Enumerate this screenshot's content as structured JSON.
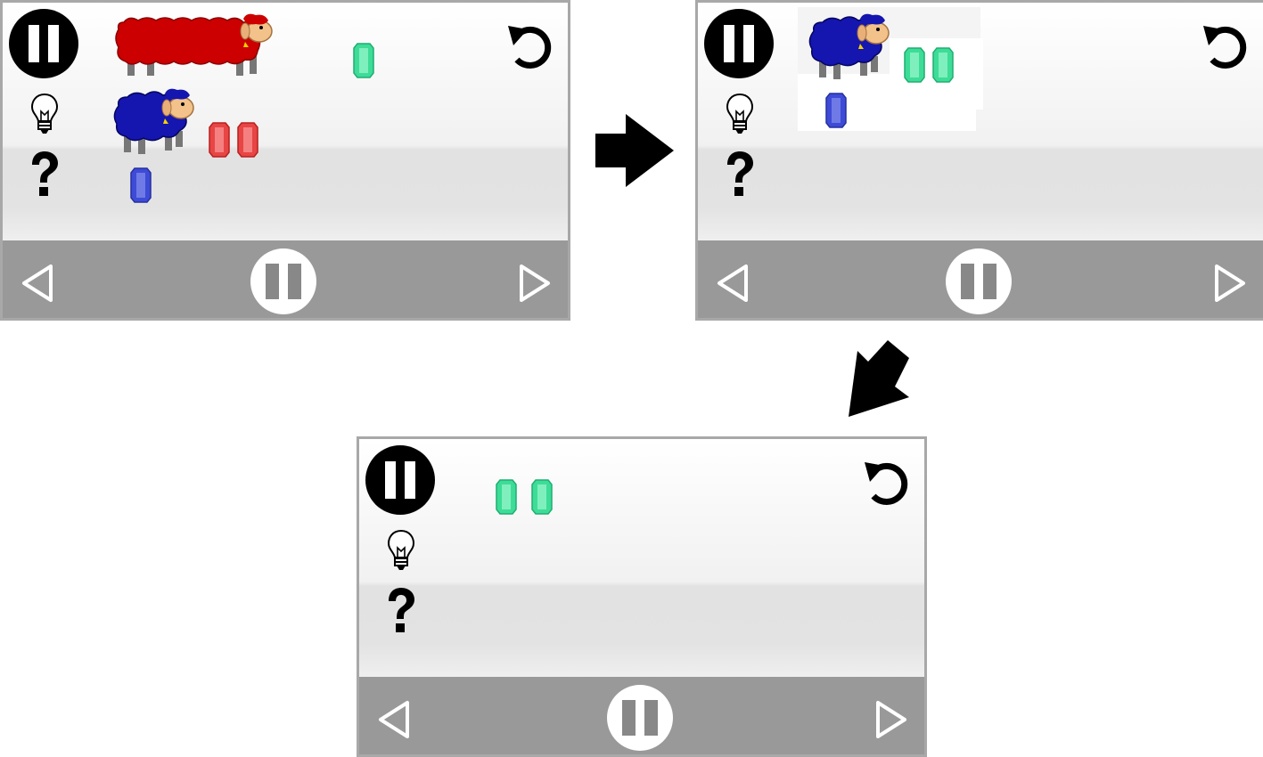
{
  "colors": {
    "red_sheep": "#cc0000",
    "blue_sheep": "#1515b0",
    "green_gem": "#3ddc97",
    "red_gem": "#e84545",
    "blue_gem": "#3d4bd6",
    "bottom_bar": "#999999",
    "panel_border": "#a8a8a8"
  },
  "icons": {
    "pause": "pause-icon",
    "hint": "lightbulb-icon",
    "help": "question-icon",
    "undo": "undo-icon",
    "previous": "triangle-left-icon",
    "next": "triangle-right-icon",
    "flow_right": "arrow-right-icon",
    "flow_down_left": "arrow-down-left-icon"
  },
  "panels": [
    {
      "id": "step-1",
      "sheep": [
        "red (stretched)",
        "blue"
      ],
      "gems": {
        "green": 1,
        "red": 2,
        "blue": 1
      }
    },
    {
      "id": "step-2",
      "sheep": [
        "blue"
      ],
      "gems": {
        "green": 2,
        "red": 0,
        "blue": 1
      }
    },
    {
      "id": "step-3",
      "sheep": [],
      "gems": {
        "green": 2,
        "red": 0,
        "blue": 0
      }
    }
  ]
}
